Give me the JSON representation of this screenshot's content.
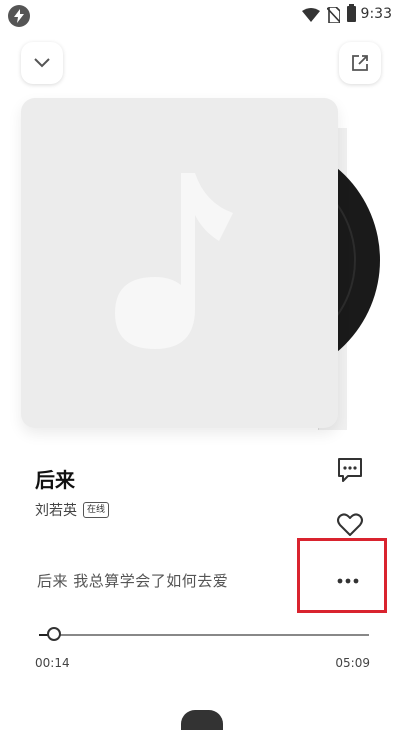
{
  "status_bar": {
    "time": "9:33",
    "icons": [
      "flash-icon",
      "wifi-icon",
      "no-sim-icon",
      "battery-icon"
    ]
  },
  "header": {
    "collapse_icon": "chevron-down-icon",
    "share_icon": "share-external-icon"
  },
  "album": {
    "cover_icon": "music-note-icon",
    "disc_icon": "vinyl-disc-icon"
  },
  "song": {
    "title": "后来",
    "artist": "刘若英",
    "badge": "在线"
  },
  "actions": {
    "comment_icon": "comment-icon",
    "favorite_icon": "heart-icon",
    "more_icon": "more-dots-icon"
  },
  "lyric": {
    "current_line": "后来 我总算学会了如何去爱"
  },
  "progress": {
    "current": "00:14",
    "total": "05:09",
    "fraction": 0.045
  },
  "colors": {
    "highlight": "#d9232e",
    "cover_bg": "#ececec"
  }
}
